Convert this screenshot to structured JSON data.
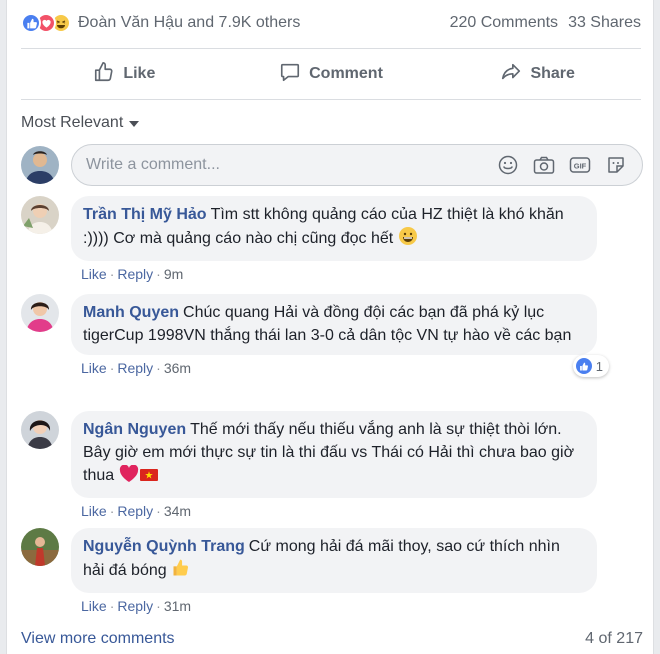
{
  "summary": {
    "names": "Đoàn Văn Hậu and 7.9K others",
    "comments": "220 Comments",
    "shares": "33 Shares",
    "reaction_icons": [
      "like-icon",
      "love-icon",
      "haha-icon"
    ]
  },
  "actions": {
    "like": "Like",
    "comment": "Comment",
    "share": "Share"
  },
  "sort": {
    "label": "Most Relevant"
  },
  "composer": {
    "placeholder": "Write a comment..."
  },
  "comments": [
    {
      "author": "Trần Thị Mỹ Hảo",
      "text": "Tìm stt không quảng cáo của HZ thiệt là khó khăn :)))) Cơ mà quảng cáo nào chị cũng đọc hết",
      "like": "Like",
      "reply": "Reply",
      "time": "9m"
    },
    {
      "author": "Manh Quyen",
      "text": "Chúc quang Hải và đồng đội các bạn đã phá kỷ lục tigerCup 1998VN thắng thái lan 3-0 cả dân tộc VN tự hào về các bạn",
      "like": "Like",
      "reply": "Reply",
      "time": "36m",
      "reactions": "1"
    },
    {
      "author": "Ngân Nguyen",
      "text": "Thế mới thấy nếu thiếu vắng anh là sự thiệt thòi lớn. Bây giờ em mới thực sự tin là thi đấu vs Thái có Hải thì chưa bao giờ thua",
      "like": "Like",
      "reply": "Reply",
      "time": "34m"
    },
    {
      "author": "Nguyễn Quỳnh Trang",
      "text": "Cứ mong hải đá mãi thoy, sao cứ thích nhìn hải đá bóng",
      "like": "Like",
      "reply": "Reply",
      "time": "31m"
    }
  ],
  "footer": {
    "view_more": "View more comments",
    "count": "4 of 217"
  },
  "colors": {
    "link": "#385898",
    "like_blue": "#4a7ff0",
    "love_red": "#f25268",
    "haha_yellow": "#f7c948"
  }
}
